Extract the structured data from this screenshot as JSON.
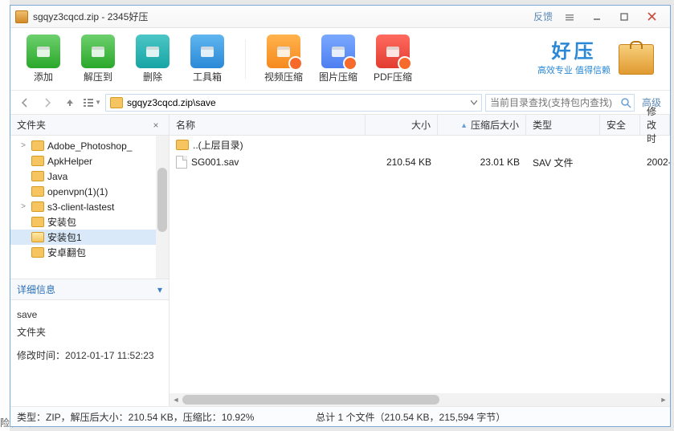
{
  "window": {
    "title": "sgqyz3cqcd.zip - 2345好压",
    "feedback": "反馈",
    "minimize_name": "minimize",
    "maximize_name": "maximize",
    "close_name": "close"
  },
  "toolbar": {
    "items": [
      {
        "label": "添加",
        "icon": "add-archive-icon",
        "bg": "linear-gradient(#6dd06d,#2aa82a)"
      },
      {
        "label": "解压到",
        "icon": "extract-icon",
        "bg": "linear-gradient(#6dd06d,#2aa82a)"
      },
      {
        "label": "删除",
        "icon": "delete-icon",
        "bg": "linear-gradient(#4cc6c6,#17a4a4)"
      },
      {
        "label": "工具箱",
        "icon": "toolbox-icon",
        "bg": "linear-gradient(#5fb6ef,#2a88d6)"
      }
    ],
    "items2": [
      {
        "label": "视频压缩",
        "icon": "video-compress-icon",
        "bg": "linear-gradient(#ffb24d,#f68a1e)"
      },
      {
        "label": "图片压缩",
        "icon": "image-compress-icon",
        "bg": "linear-gradient(#7aa9ff,#4d7ef0)"
      },
      {
        "label": "PDF压缩",
        "icon": "pdf-compress-icon",
        "bg": "linear-gradient(#ff6a5f,#e23d30)"
      }
    ],
    "brand_big": "好压",
    "brand_sub": "高效专业 值得信赖"
  },
  "navbar": {
    "path": "sgqyz3cqcd.zip\\save",
    "search_placeholder": "当前目录查找(支持包内查找)",
    "advanced": "高级"
  },
  "sidebar": {
    "folders_header": "文件夹",
    "tree": [
      {
        "label": "Adobe_Photoshop_",
        "depth": 0,
        "twist": ">"
      },
      {
        "label": "ApkHelper",
        "depth": 0,
        "twist": ""
      },
      {
        "label": "Java",
        "depth": 0,
        "twist": ""
      },
      {
        "label": "openvpn(1)(1)",
        "depth": 0,
        "twist": ""
      },
      {
        "label": "s3-client-lastest",
        "depth": 0,
        "twist": ">"
      },
      {
        "label": "安装包",
        "depth": 0,
        "twist": ""
      },
      {
        "label": "安装包1",
        "depth": 0,
        "twist": "",
        "selected": true,
        "open": true
      },
      {
        "label": "安卓翻包",
        "depth": 0,
        "twist": ""
      }
    ],
    "details_header": "详细信息",
    "detail_name": "save",
    "detail_type": "文件夹",
    "detail_mtime_label": "修改时间：",
    "detail_mtime": "2012-01-17 11:52:23"
  },
  "columns": {
    "name": "名称",
    "size": "大小",
    "compressed": "压缩后大小",
    "type": "类型",
    "safe": "安全",
    "modified": "修改时"
  },
  "rows": [
    {
      "name": "..(上层目录)",
      "size": "",
      "compressed": "",
      "type": "",
      "safe": "",
      "modified": "",
      "kind": "folder"
    },
    {
      "name": "SG001.sav",
      "size": "210.54 KB",
      "compressed": "23.01 KB",
      "type": "SAV 文件",
      "safe": "",
      "modified": "2002-",
      "kind": "file"
    }
  ],
  "status": {
    "left": "类型：ZIP，解压后大小：210.54 KB，压缩比：10.92%",
    "center": "总计 1 个文件（210.54 KB，215,594 字节）"
  },
  "bg_peek": "险和无限"
}
